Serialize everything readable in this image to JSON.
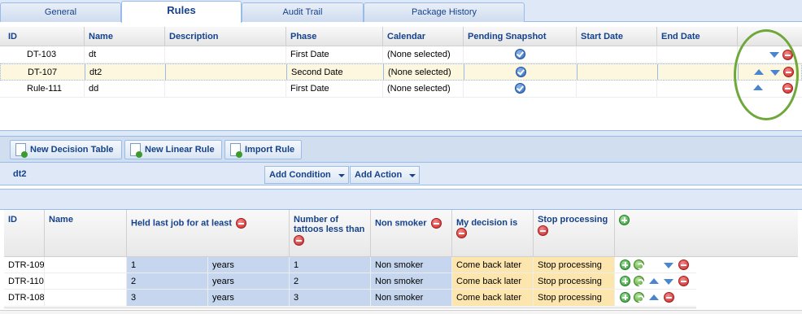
{
  "tabs": [
    {
      "label": "General"
    },
    {
      "label": "Rules"
    },
    {
      "label": "Audit Trail"
    },
    {
      "label": "Package History"
    }
  ],
  "rules_grid": {
    "columns": [
      "ID",
      "Name",
      "Description",
      "Phase",
      "Calendar",
      "Pending Snapshot",
      "Start Date",
      "End Date"
    ],
    "rows": [
      {
        "id": "DT-103",
        "name": "dt",
        "description": "",
        "phase": "First Date",
        "calendar": "(None selected)",
        "up": false,
        "down": true
      },
      {
        "id": "DT-107",
        "name": "dt2",
        "description": "",
        "phase": "Second Date",
        "calendar": "(None selected)",
        "up": true,
        "down": true,
        "selected": true
      },
      {
        "id": "Rule-111",
        "name": "dd",
        "description": "",
        "phase": "First Date",
        "calendar": "(None selected)",
        "up": true,
        "down": false
      }
    ]
  },
  "toolbar": {
    "new_decision_table": "New Decision Table",
    "new_linear_rule": "New Linear Rule",
    "import_rule": "Import Rule"
  },
  "editor": {
    "rule_name": "dt2",
    "add_condition": "Add Condition",
    "add_action": "Add Action"
  },
  "decision_table": {
    "headers": {
      "id": "ID",
      "name": "Name",
      "held_last_job": "Held last job for at least",
      "tattoos": "Number of tattoos less than",
      "non_smoker": "Non smoker",
      "my_decision": "My decision is",
      "stop_processing": "Stop processing"
    },
    "rows": [
      {
        "id": "DTR-109",
        "name": "",
        "held": "1",
        "unit": "years",
        "tattoos": "1",
        "non_smoker": "Non smoker",
        "decision": "Come back later",
        "stop": "Stop processing",
        "up": false,
        "down": true
      },
      {
        "id": "DTR-110",
        "name": "",
        "held": "2",
        "unit": "years",
        "tattoos": "2",
        "non_smoker": "Non smoker",
        "decision": "Come back later",
        "stop": "Stop processing",
        "up": true,
        "down": true
      },
      {
        "id": "DTR-108",
        "name": "",
        "held": "3",
        "unit": "years",
        "tattoos": "3",
        "non_smoker": "Non smoker",
        "decision": "Come back later",
        "stop": "Stop processing",
        "up": true,
        "down": false
      }
    ]
  }
}
